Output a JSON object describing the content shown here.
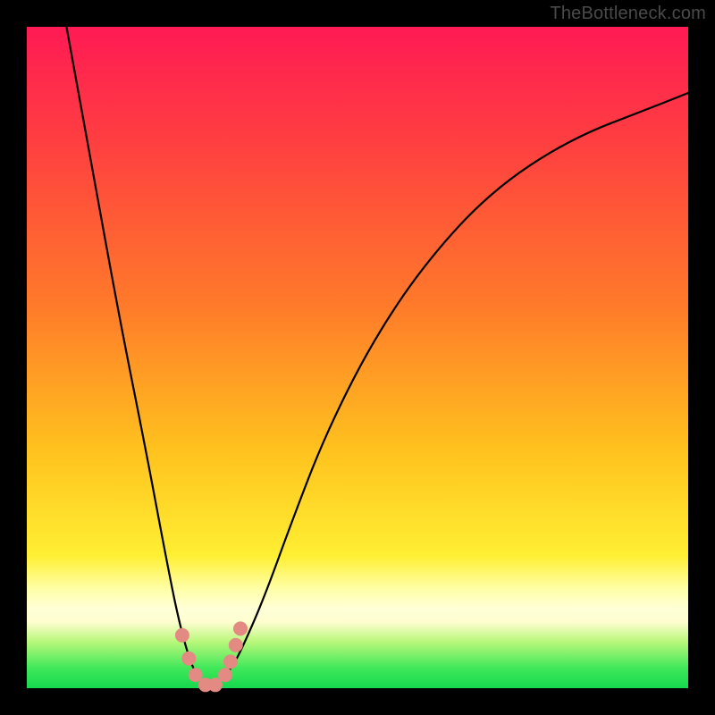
{
  "watermark": "TheBottleneck.com",
  "colors": {
    "gradient_top": "#ff1a54",
    "gradient_mid1": "#ff7a2a",
    "gradient_mid2": "#ffef33",
    "gradient_pale": "#ffffd8",
    "gradient_bottom": "#16d84e",
    "curve": "#000000",
    "marker": "#e38a82",
    "frame": "#000000"
  },
  "chart_data": {
    "type": "line",
    "title": "",
    "xlabel": "",
    "ylabel": "",
    "xlim": [
      0,
      100
    ],
    "ylim": [
      0,
      100
    ],
    "grid": false,
    "legend": false,
    "description": "V-shaped bottleneck curve. Left branch descends steeply from top-left; right branch rises steeply then tapers toward upper right. Valley bottoms out near x≈27 at y≈0. Background is a vertical red→orange→yellow→green gradient indicating bottleneck severity (top=bad, bottom=good).",
    "series": [
      {
        "name": "bottleneck-curve",
        "x": [
          6,
          10,
          14,
          18,
          21,
          23,
          25,
          27,
          29,
          31,
          33,
          36,
          40,
          45,
          52,
          60,
          70,
          82,
          95,
          100
        ],
        "y": [
          100,
          78,
          56,
          36,
          20,
          10,
          3,
          0,
          1,
          3,
          7,
          14,
          25,
          38,
          52,
          64,
          75,
          83,
          88,
          90
        ]
      }
    ],
    "markers": {
      "name": "valley-markers",
      "x": [
        23.5,
        24.5,
        25.5,
        27.0,
        28.5,
        30.0,
        30.8,
        31.6,
        32.3
      ],
      "y": [
        8.0,
        4.5,
        2.0,
        0.5,
        0.5,
        2.0,
        4.0,
        6.5,
        9.0
      ],
      "r": [
        8,
        8,
        8,
        8,
        8,
        8,
        8,
        8,
        8
      ]
    }
  }
}
